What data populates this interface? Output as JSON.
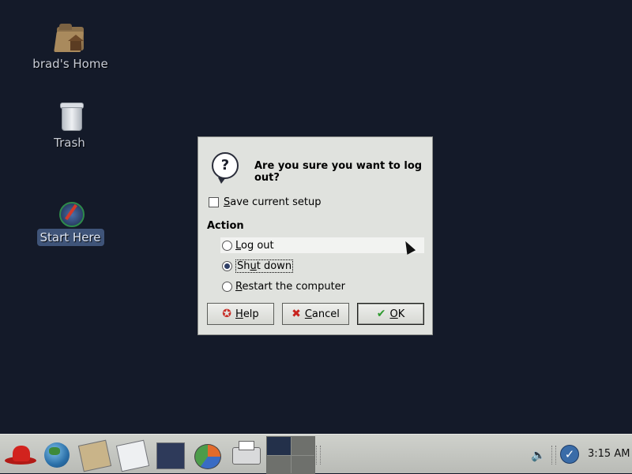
{
  "desktop": {
    "icons": [
      {
        "label": "brad's Home",
        "icon": "home-folder-icon"
      },
      {
        "label": "Trash",
        "icon": "trash-icon"
      },
      {
        "label": "Start Here",
        "icon": "start-here-icon"
      }
    ]
  },
  "dialog": {
    "question": "Are you sure you want to log out?",
    "save_setup": {
      "prefix": "",
      "mnemonic": "S",
      "rest": "ave current setup",
      "checked": false
    },
    "action_label": "Action",
    "options": [
      {
        "mnemonic": "L",
        "rest": "og out",
        "selected": false
      },
      {
        "pre": "Sh",
        "mnemonic": "u",
        "rest": "t down",
        "selected": true
      },
      {
        "mnemonic": "R",
        "rest": "estart the computer",
        "selected": false
      }
    ],
    "buttons": {
      "help": {
        "mnemonic": "H",
        "rest": "elp",
        "icon": "lifebuoy-icon"
      },
      "cancel": {
        "mnemonic": "C",
        "rest": "ancel",
        "icon": "red-x-icon"
      },
      "ok": {
        "mnemonic": "O",
        "rest": "K",
        "icon": "green-check-icon"
      }
    }
  },
  "panel": {
    "clock": "3:15 AM",
    "launchers": [
      "redhat-menu-icon",
      "web-browser-icon",
      "email-icon",
      "writer-icon",
      "spreadsheet-icon",
      "presentation-icon",
      "print-manager-icon"
    ],
    "workspaces": 4,
    "active_workspace": 1
  },
  "colors": {
    "desktop_bg": "#141a29",
    "dialog_bg": "#e0e2de",
    "selection": "#3f5479"
  }
}
